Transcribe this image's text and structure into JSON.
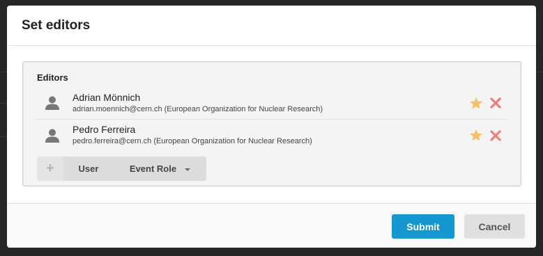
{
  "dialog": {
    "title": "Set editors"
  },
  "editors": {
    "section_label": "Editors",
    "people": [
      {
        "name": "Adrian Mönnich",
        "email": "adrian.moennich@cern.ch (European Organization for Nuclear Research)",
        "icon": "person-icon"
      },
      {
        "name": "Pedro Ferreira",
        "email": "pedro.ferreira@cern.ch (European Organization for Nuclear Research)",
        "icon": "person-icon"
      }
    ]
  },
  "add_controls": {
    "plus_label": "+",
    "user_label": "User",
    "role_label": "Event Role"
  },
  "footer": {
    "submit_label": "Submit",
    "cancel_label": "Cancel"
  },
  "colors": {
    "star": "#f0c36a",
    "remove": "#f07d7d",
    "submit": "#1498cf",
    "avatar": "#777777"
  }
}
